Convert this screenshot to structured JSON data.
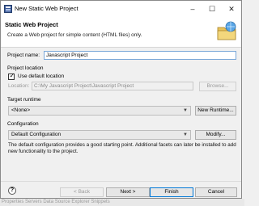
{
  "window": {
    "title": "New Static Web Project"
  },
  "header": {
    "title": "Static Web Project",
    "description": "Create a Web project for simple content (HTML files) only."
  },
  "form": {
    "project_name_label": "Project name:",
    "project_name_value": "Javascript Project",
    "location_group_label": "Project location",
    "use_default_label": "Use default location",
    "use_default_checked": true,
    "location_label": "Location:",
    "location_value": "C:\\My Javascript Project\\Javascript Project",
    "browse_label": "Browse...",
    "target_runtime_label": "Target runtime",
    "target_runtime_value": "<None>",
    "new_runtime_label": "New Runtime...",
    "configuration_label": "Configuration",
    "configuration_value": "Default Configuration",
    "modify_label": "Modify...",
    "configuration_info": "The default configuration provides a good starting point. Additional facets can later be installed to add new functionality to the project."
  },
  "footer": {
    "help_icon": "?",
    "back_label": "< Back",
    "next_label": "Next >",
    "finish_label": "Finish",
    "cancel_label": "Cancel"
  },
  "background": {
    "strip_text": "Properties   Servers   Data Source Explorer   Snippets"
  },
  "colors": {
    "accent": "#0078d7",
    "window_bg": "#f0f0f0",
    "header_bg": "#ffffff"
  }
}
